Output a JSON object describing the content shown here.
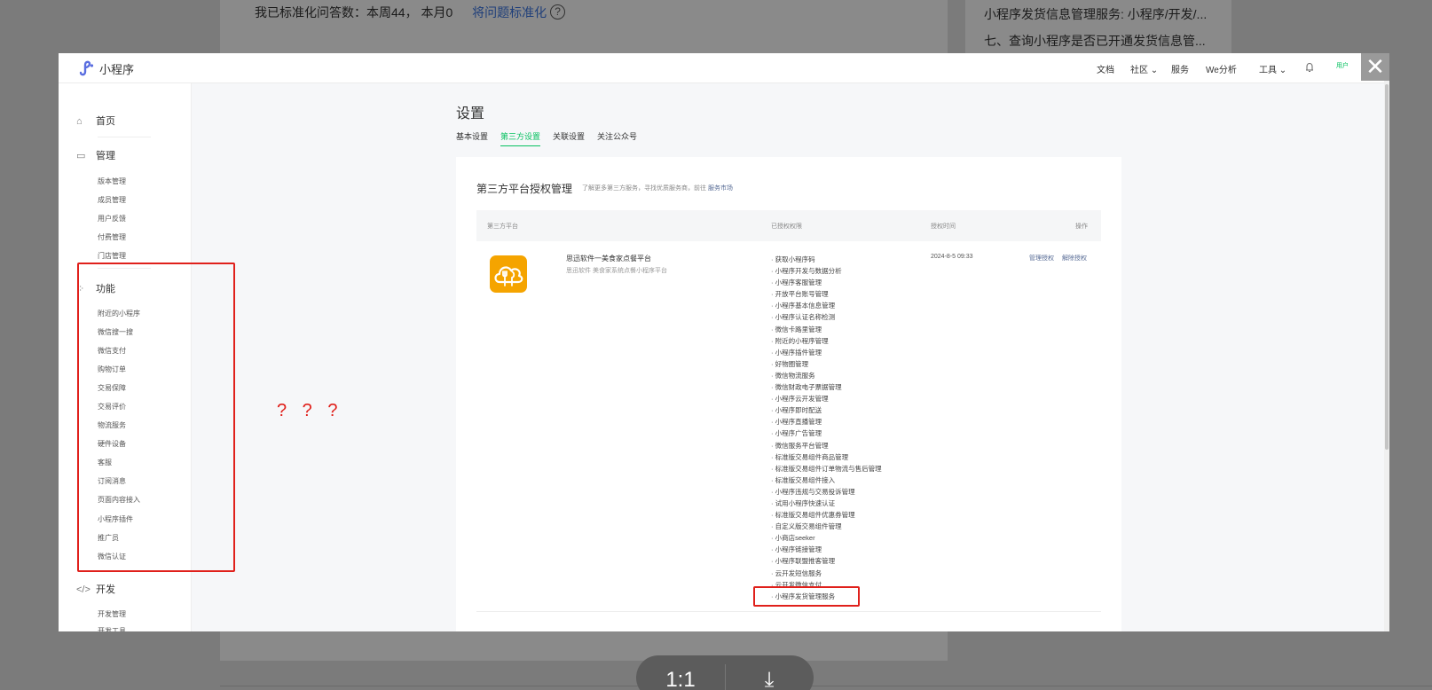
{
  "background": {
    "stats_text": "我已标准化问答数：本周44， 本月0",
    "stats_link": "将问题标准化",
    "help_symbol": "?",
    "right_items": [
      "小程序发货信息管理服务: 小程序/开发/...",
      "七、查询小程序是否已开通发货信息管..."
    ]
  },
  "viewer": {
    "ratio_label": "1:1",
    "download_icon": "⤓"
  },
  "modal": {
    "close_symbol": "✕",
    "topbar": {
      "logo_text": "小程序",
      "nav": [
        "文档",
        "社区",
        "服务",
        "We分析",
        "工具"
      ],
      "avatar_text": "用户"
    },
    "sidebar": {
      "groups": [
        {
          "label": "首页",
          "icon": "⌂",
          "items": []
        },
        {
          "label": "管理",
          "icon": "▭",
          "items": [
            "版本管理",
            "成员管理",
            "用户反馈",
            "付费管理",
            "门店管理"
          ]
        },
        {
          "label": "功能",
          "icon": "⁘",
          "items": [
            "附近的小程序",
            "微信搜一搜",
            "微信支付",
            "购物订单",
            "交易保障",
            "交易评价",
            "物流服务",
            "硬件设备",
            "客服",
            "订阅消息",
            "页面内容接入",
            "小程序插件",
            "推广员",
            "微信认证"
          ]
        },
        {
          "label": "开发",
          "icon": "</>",
          "items": [
            "开发管理",
            "开发工具"
          ]
        }
      ]
    },
    "annotation_text": "? ? ?",
    "page": {
      "title": "设置",
      "tabs": [
        "基本设置",
        "第三方设置",
        "关联设置",
        "关注公众号"
      ],
      "active_tab": 1,
      "card": {
        "title": "第三方平台授权管理",
        "subtitle": "了解更多第三方服务，寻找优质服务商，前往",
        "subtitle_link": "服务市场",
        "columns": [
          "第三方平台",
          "已授权权限",
          "授权时间",
          "操作"
        ],
        "row": {
          "app_name": "思迅软件一美食家点餐平台",
          "app_desc": "思迅软件 美食家系统点餐小程序平台",
          "auth_time": "2024-8-5 09:33",
          "actions": [
            "管理授权",
            "解除授权"
          ],
          "permissions": [
            "· 获取小程序码",
            "· 小程序开发与数据分析",
            "· 小程序客服管理",
            "· 开放平台账号管理",
            "· 小程序基本信息管理",
            "· 小程序认证名称检测",
            "· 微信卡路里管理",
            "· 附近的小程序管理",
            "· 小程序插件管理",
            "· 好物圈管理",
            "· 微信物流服务",
            "· 微信财政电子票据管理",
            "· 小程序云开发管理",
            "· 小程序即时配送",
            "· 小程序直播管理",
            "· 小程序广告管理",
            "· 微信服务平台管理",
            "· 标准版交易组件商品管理",
            "· 标准版交易组件订单物流与售后管理",
            "· 标准版交易组件接入",
            "· 小程序违规与交易投诉管理",
            "· 试用小程序快速认证",
            "· 标准版交易组件优惠券管理",
            "· 自定义版交易组件管理",
            "· 小商店seeker",
            "· 小程序链接管理",
            "· 小程序联盟推客管理",
            "· 云开发短信服务",
            "· 云开发微信支付",
            "· 小程序发货管理服务"
          ]
        }
      }
    }
  }
}
